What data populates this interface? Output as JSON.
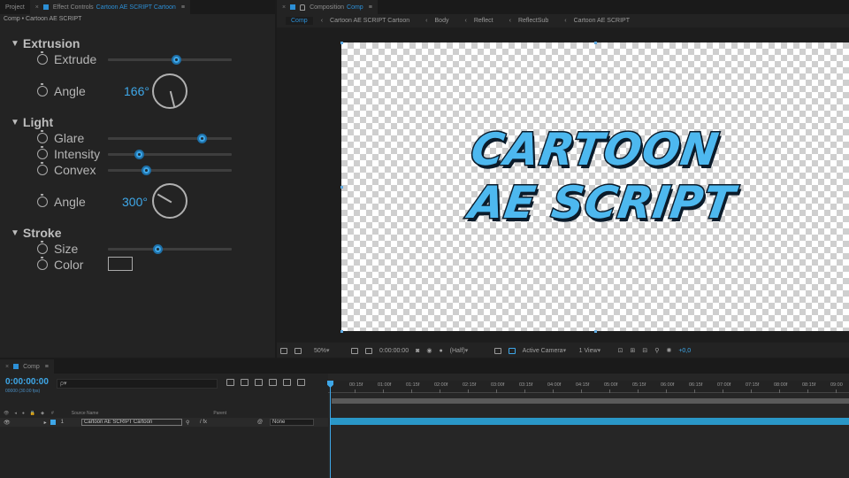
{
  "left_tabs": {
    "project": "Project",
    "effect_controls": "Effect Controls",
    "effect_target": "Cartoon AE SCRIPT Cartoon"
  },
  "left_breadcrumb": "Comp • Cartoon AE SCRIPT",
  "effects": {
    "extrusion": {
      "title": "Extrusion",
      "extrude": {
        "label": "Extrude",
        "value": 0.55
      },
      "angle": {
        "label": "Angle",
        "value": "166°",
        "degrees": 166
      }
    },
    "light": {
      "title": "Light",
      "glare": {
        "label": "Glare",
        "value": 0.76
      },
      "intensity": {
        "label": "Intensity",
        "value": 0.25
      },
      "convex": {
        "label": "Convex",
        "value": 0.31
      },
      "angle": {
        "label": "Angle",
        "value": "300°",
        "degrees": 300
      }
    },
    "stroke": {
      "title": "Stroke",
      "size": {
        "label": "Size",
        "value": 0.4
      },
      "color": {
        "label": "Color",
        "swatch": "#222222"
      }
    }
  },
  "comp_tab": {
    "prefix": "Composition",
    "name": "Comp"
  },
  "comp_crumbs": [
    "Comp",
    "Cartoon AE SCRIPT Cartoon",
    "Body",
    "Reflect",
    "ReflectSub",
    "Cartoon AE SCRIPT"
  ],
  "artwork": {
    "line1": "CARTOON",
    "line2": "AE SCRIPT",
    "fill_color": "#4db8ef",
    "stroke_color": "#0b1b2a"
  },
  "comp_toolbar": {
    "zoom": "50%",
    "time": "0:00:00:00",
    "resolution": "(Half)",
    "camera": "Active Camera",
    "views": "1 View",
    "exposure": "+0,0"
  },
  "timeline": {
    "tab": "Comp",
    "timecode": "0:00:00:00",
    "fps": "00000 (30.00 fps)",
    "search_placeholder": "ρ▾",
    "col_source": "Source Name",
    "col_parent": "Parent",
    "layer": {
      "index": "1",
      "name": "Cartoon AE SCRIPT Cartoon",
      "parent": "None"
    },
    "ruler": [
      "00:15f",
      "01:00f",
      "01:15f",
      "02:00f",
      "02:15f",
      "03:00f",
      "03:15f",
      "04:00f",
      "04:15f",
      "05:00f",
      "05:15f",
      "06:00f",
      "06:15f",
      "07:00f",
      "07:15f",
      "08:00f",
      "08:15f",
      "09:00"
    ]
  },
  "accent_color": "#3ea7e8"
}
